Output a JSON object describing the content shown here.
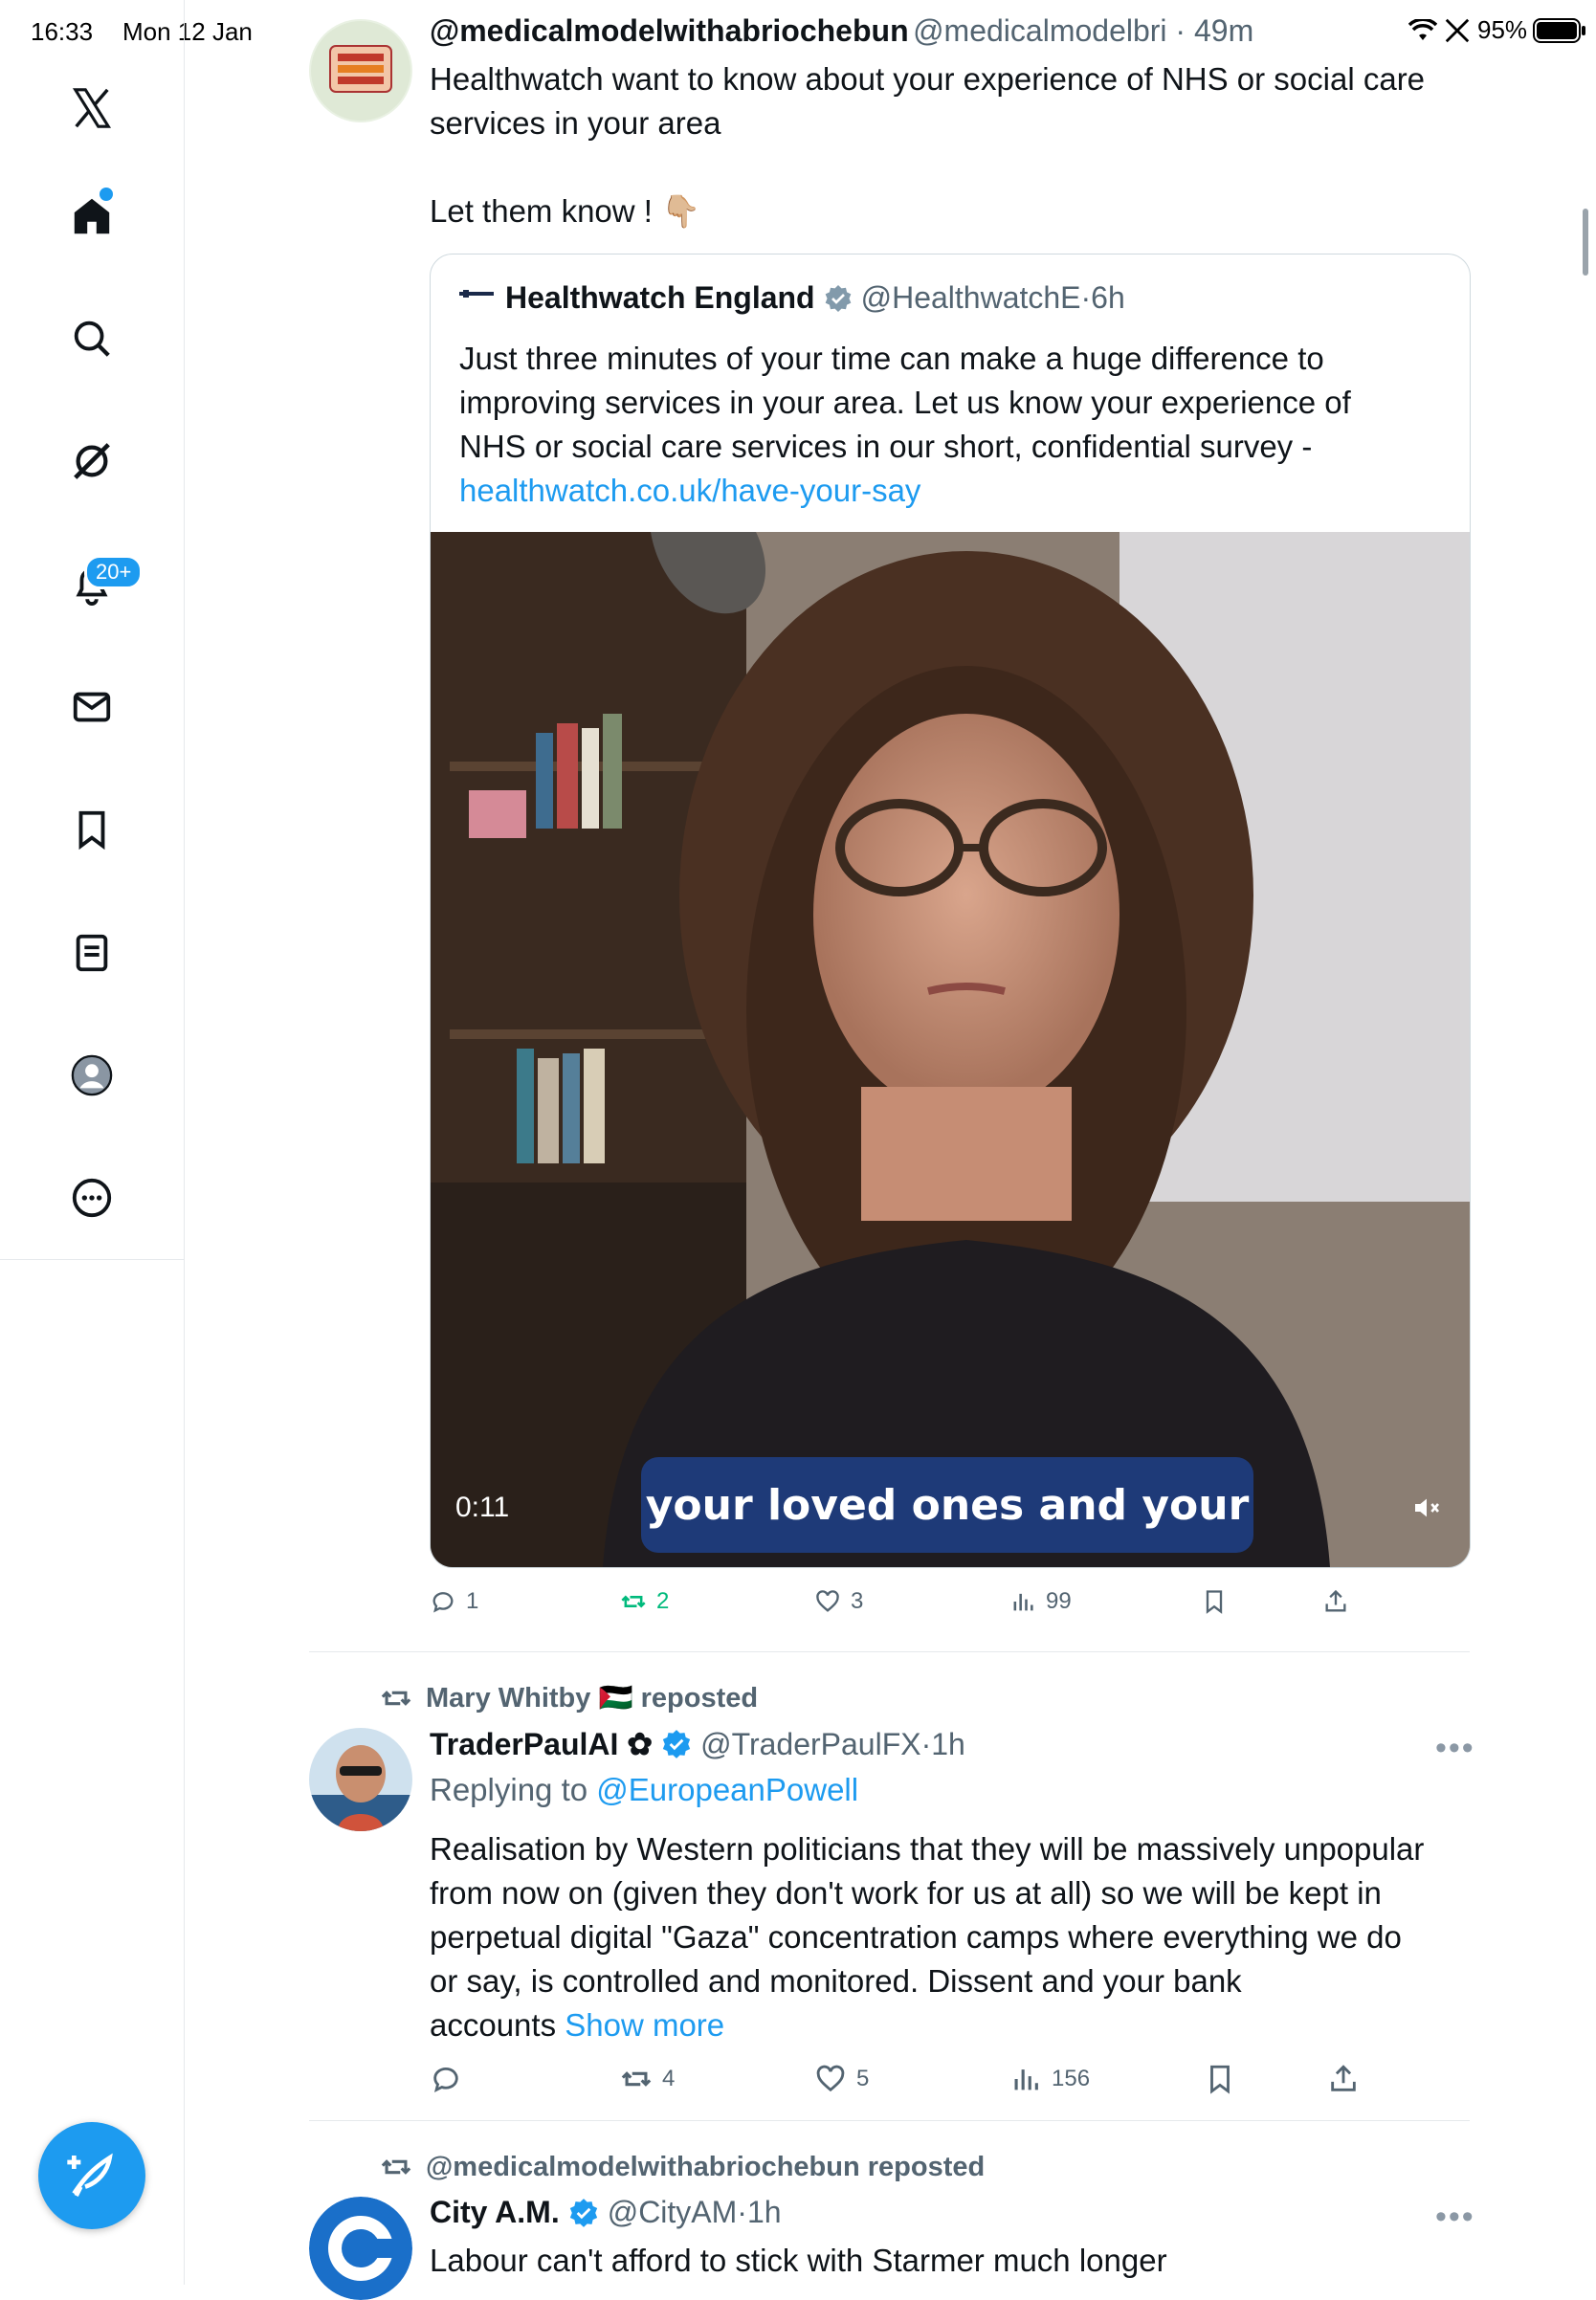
{
  "status_bar": {
    "time": "16:33",
    "date": "Mon 12 Jan",
    "battery": "95%"
  },
  "sidebar": {
    "notifications_badge": "20+",
    "items": [
      "x-logo-icon",
      "home-icon",
      "search-icon",
      "grok-icon",
      "notifications-icon",
      "messages-icon",
      "bookmarks-icon",
      "lists-icon",
      "profile-icon",
      "more-icon"
    ]
  },
  "tweet1": {
    "display_name": "@medicalmodelwithabriochebun",
    "handle": "@medicalmodelbri",
    "time": "49m",
    "text_line1": "Healthwatch want to know about your experience of NHS or social care",
    "text_line2": "services in your area",
    "text_line3": "Let them know ! 👇🏼",
    "quote": {
      "display_name": "Healthwatch England",
      "handle": "@HealthwatchE",
      "time": "6h",
      "text_line1": "Just three minutes of your time can make a huge difference to",
      "text_line2": "improving services in your area. Let us know your experience of",
      "text_line3": "NHS or social care services in our short, confidential survey -",
      "link": "healthwatch.co.uk/have-your-say",
      "video_time": "0:11",
      "caption": "your loved ones and your"
    },
    "actions": {
      "replies": "1",
      "reposts": "2",
      "likes": "3",
      "views": "99"
    }
  },
  "tweet2": {
    "reposted_by": "Mary Whitby 🇵🇸 reposted",
    "display_name": "TraderPaulAI ✿",
    "handle": "@TraderPaulFX",
    "time": "1h",
    "replying_prefix": "Replying to ",
    "replying_to": "@EuropeanPowell",
    "text_line1": "Realisation by Western politicians that they will be massively unpopular",
    "text_line2": "from now on (given they don't work for us at all) so we will be kept in",
    "text_line3": "perpetual digital \"Gaza\" concentration camps where everything we do",
    "text_line4": "or say, is controlled and monitored. Dissent and your bank",
    "text_line5": "accounts ",
    "show_more": "Show more",
    "actions": {
      "replies": "",
      "reposts": "4",
      "likes": "5",
      "views": "156"
    }
  },
  "tweet3": {
    "reposted_by": "@medicalmodelwithabriochebun reposted",
    "display_name": "City A.M.",
    "handle": "@CityAM",
    "time": "1h",
    "text_line1": "Labour can't afford to stick with Starmer much longer"
  },
  "colors": {
    "accent": "#1d9bf0",
    "repost_green": "#00ba7c",
    "muted": "#536471"
  }
}
